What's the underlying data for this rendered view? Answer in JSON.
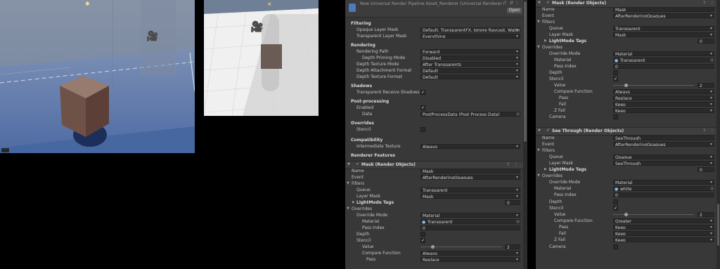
{
  "panelA": {
    "title": "New Universal Render Pipeline Asset_Renderer (Universal Renderer Data)",
    "open_button": "Open",
    "filtering": {
      "header": "Filtering",
      "opaque_label": "Opaque Layer Mask",
      "opaque_value": "Default, TransparentFX, Ignore Raycast, Water, UI",
      "transparent_label": "Transparent Layer Mask",
      "transparent_value": "Everything"
    },
    "rendering": {
      "header": "Rendering",
      "path_label": "Rendering Path",
      "path_value": "Forward",
      "priming_label": "Depth Priming Mode",
      "priming_value": "Disabled",
      "texmode_label": "Depth Texture Mode",
      "texmode_value": "After Transparents",
      "attach_label": "Depth Attachment Format",
      "attach_value": "Default",
      "texfmt_label": "Depth Texture Format",
      "texfmt_value": "Default"
    },
    "shadows": {
      "header": "Shadows",
      "receive_label": "Transparent Receive Shadows",
      "receive_checked": "✓"
    },
    "postprocessing": {
      "header": "Post-processing",
      "enabled_label": "Enabled",
      "enabled_checked": "✓",
      "data_label": "Data",
      "data_value": "PostProcessData (Post Process Data)"
    },
    "overrides": {
      "header": "Overrides",
      "stencil_label": "Stencil"
    },
    "compatibility": {
      "header": "Compatibility",
      "inter_label": "Intermediate Texture",
      "inter_value": "Always"
    },
    "features_header": "Renderer Features",
    "feature": {
      "title": "Mask (Render Objects)",
      "check": "✓",
      "name_label": "Name",
      "name_value": "Mask",
      "event_label": "Event",
      "event_value": "AfterRenderingOpaques",
      "filters": "Filters",
      "queue_label": "Queue",
      "queue_value": "Transparent",
      "layer_label": "Layer Mask",
      "layer_value": "Mask",
      "tags_label": "LightMode Tags",
      "tags_value": "0",
      "overrides": "Overrides",
      "ovmode_label": "Override Mode",
      "ovmode_value": "Material",
      "mat_label": "Material",
      "mat_value": "Transparent",
      "pass_label": "Pass Index",
      "pass_value": "0",
      "depth_label": "Depth",
      "stencil_label": "Stencil",
      "stencil_check": "✓",
      "value_label": "Value",
      "value_value": "2",
      "compare_label": "Compare Function",
      "compare_value": "Always",
      "pass2_label": "Pass",
      "pass2_value": "Replace"
    }
  },
  "panelB": {
    "feature1": {
      "title": "Mask (Render Objects)",
      "check": "✓",
      "name_label": "Name",
      "name_value": "Mask",
      "event_label": "Event",
      "event_value": "AfterRenderingOpaques",
      "filters": "Filters",
      "queue_label": "Queue",
      "queue_value": "Transparent",
      "layer_label": "Layer Mask",
      "layer_value": "Mask",
      "tags_label": "LightMode Tags",
      "tags_value": "0",
      "overrides": "Overrides",
      "ovmode_label": "Override Mode",
      "ovmode_value": "Material",
      "mat_label": "Material",
      "mat_value": "Transparent",
      "pass_label": "Pass Index",
      "pass_value": "0",
      "depth_label": "Depth",
      "stencil_label": "Stencil",
      "stencil_check": "✓",
      "value_label": "Value",
      "value_value": "2",
      "compare_label": "Compare Function",
      "compare_value": "Always",
      "pass2_label": "Pass",
      "pass2_value": "Replace",
      "fail_label": "Fail",
      "fail_value": "Keep",
      "zfail_label": "Z Fail",
      "zfail_value": "Keep",
      "camera_label": "Camera"
    },
    "feature2": {
      "title": "See Through (Render Objects)",
      "check": "✓",
      "name_label": "Name",
      "name_value": "SeeThrough",
      "event_label": "Event",
      "event_value": "AfterRenderingOpaques",
      "filters": "Filters",
      "queue_label": "Queue",
      "queue_value": "Opaque",
      "layer_label": "Layer Mask",
      "layer_value": "SeeThrough",
      "tags_label": "LightMode Tags",
      "tags_value": "0",
      "overrides": "Overrides",
      "ovmode_label": "Override Mode",
      "ovmode_value": "Material",
      "mat_label": "Material",
      "mat_value": "white",
      "pass_label": "Pass Index",
      "pass_value": "0",
      "depth_label": "Depth",
      "stencil_label": "Stencil",
      "stencil_check": "✓",
      "value_label": "Value",
      "value_value": "2",
      "compare_label": "Compare Function",
      "compare_value": "Greater",
      "pass2_label": "Pass",
      "pass2_value": "Keep",
      "fail_label": "Fail",
      "fail_value": "Keep",
      "zfail_label": "Z Fail",
      "zfail_value": "Keep",
      "camera_label": "Camera"
    }
  }
}
